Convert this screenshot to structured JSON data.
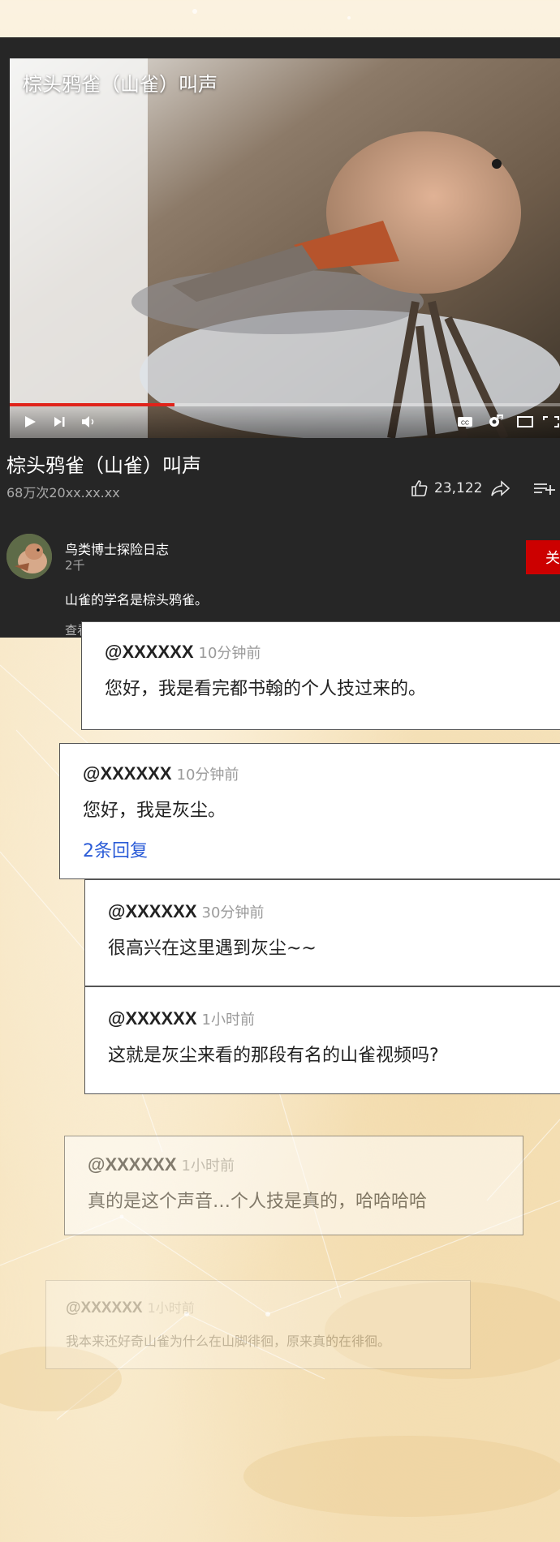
{
  "video": {
    "overlay_title": "棕头鸦雀（山雀）叫声",
    "progress": 0.3
  },
  "info": {
    "title": "棕头鸦雀（山雀）叫声",
    "meta": "68万次20xx.xx.xx",
    "likes": "23,122"
  },
  "channel": {
    "name": "鸟类博士探险日志",
    "subs": "2千",
    "subscribe_label": "关注",
    "description": "山雀的学名是棕头鸦雀。",
    "more_label": "查看更多"
  },
  "comments": [
    {
      "user": "@XXXXXX",
      "time": "10分钟前",
      "text": "您好，我是看完都书翰的个人技过来的。"
    },
    {
      "user": "@XXXXXX",
      "time": "10分钟前",
      "text": "您好，我是灰尘。",
      "replies": "2条回复"
    },
    {
      "user": "@XXXXXX",
      "time": "30分钟前",
      "text": "很高兴在这里遇到灰尘~~"
    },
    {
      "user": "@XXXXXX",
      "time": "1小时前",
      "text": "这就是灰尘来看的那段有名的山雀视频吗?"
    },
    {
      "user": "@XXXXXX",
      "time": "1小时前",
      "text": "真的是这个声音…个人技是真的，哈哈哈哈"
    },
    {
      "user": "@XXXXXX",
      "time": "1小时前",
      "text": "我本来还好奇山雀为什么在山脚徘徊，原来真的在徘徊。"
    }
  ],
  "icons": [
    "play-icon",
    "next-icon",
    "volume-icon",
    "captions-icon",
    "settings-icon",
    "miniplayer-icon",
    "fullscreen-icon",
    "thumbs-up-icon",
    "share-icon",
    "add-to-playlist-icon"
  ],
  "colors": {
    "subscribe": "#cc0000",
    "progress": "#e0231a",
    "reply_link": "#2a5bd7"
  }
}
